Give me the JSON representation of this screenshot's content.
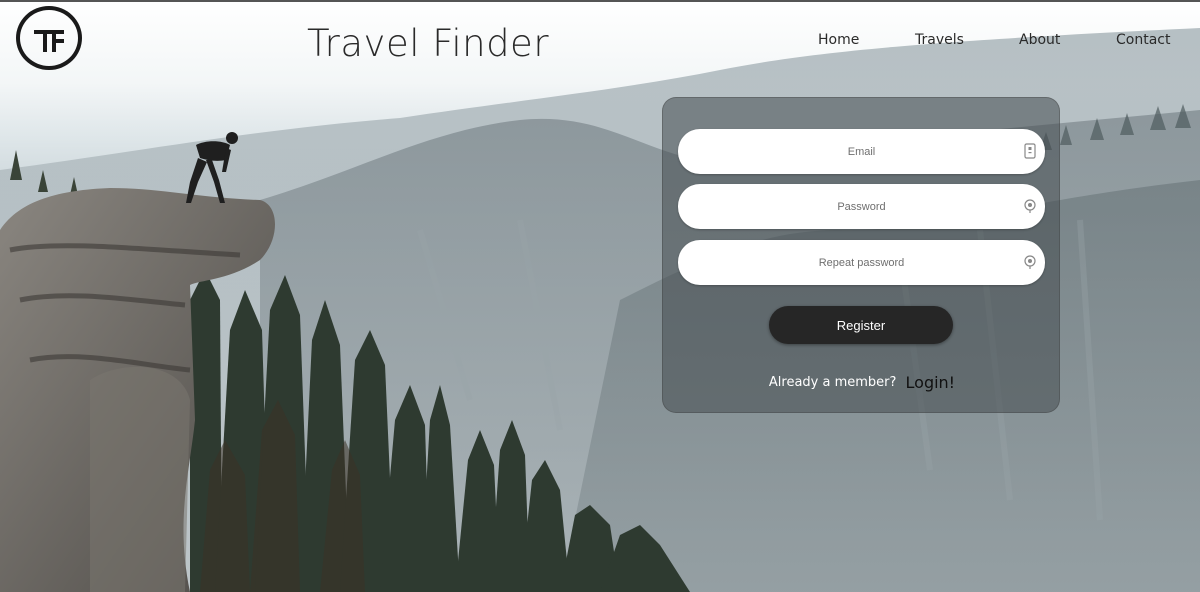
{
  "header": {
    "site_title": "Travel Finder",
    "logo_text": "TF",
    "nav": {
      "home": "Home",
      "travels": "Travels",
      "about": "About",
      "contact": "Contact"
    }
  },
  "register_form": {
    "email_placeholder": "Email",
    "password_placeholder": "Password",
    "repeat_password_placeholder": "Repeat password",
    "register_label": "Register",
    "member_prompt": "Already a member?",
    "login_label": "Login!"
  },
  "icons": {
    "email_field": "id-card-icon",
    "password_field": "key-icon",
    "repeat_password_field": "key-icon"
  },
  "colors": {
    "text_dark": "#2a2a2a",
    "button_bg": "#262626",
    "card_bg": "rgba(70,76,80,0.55)"
  }
}
